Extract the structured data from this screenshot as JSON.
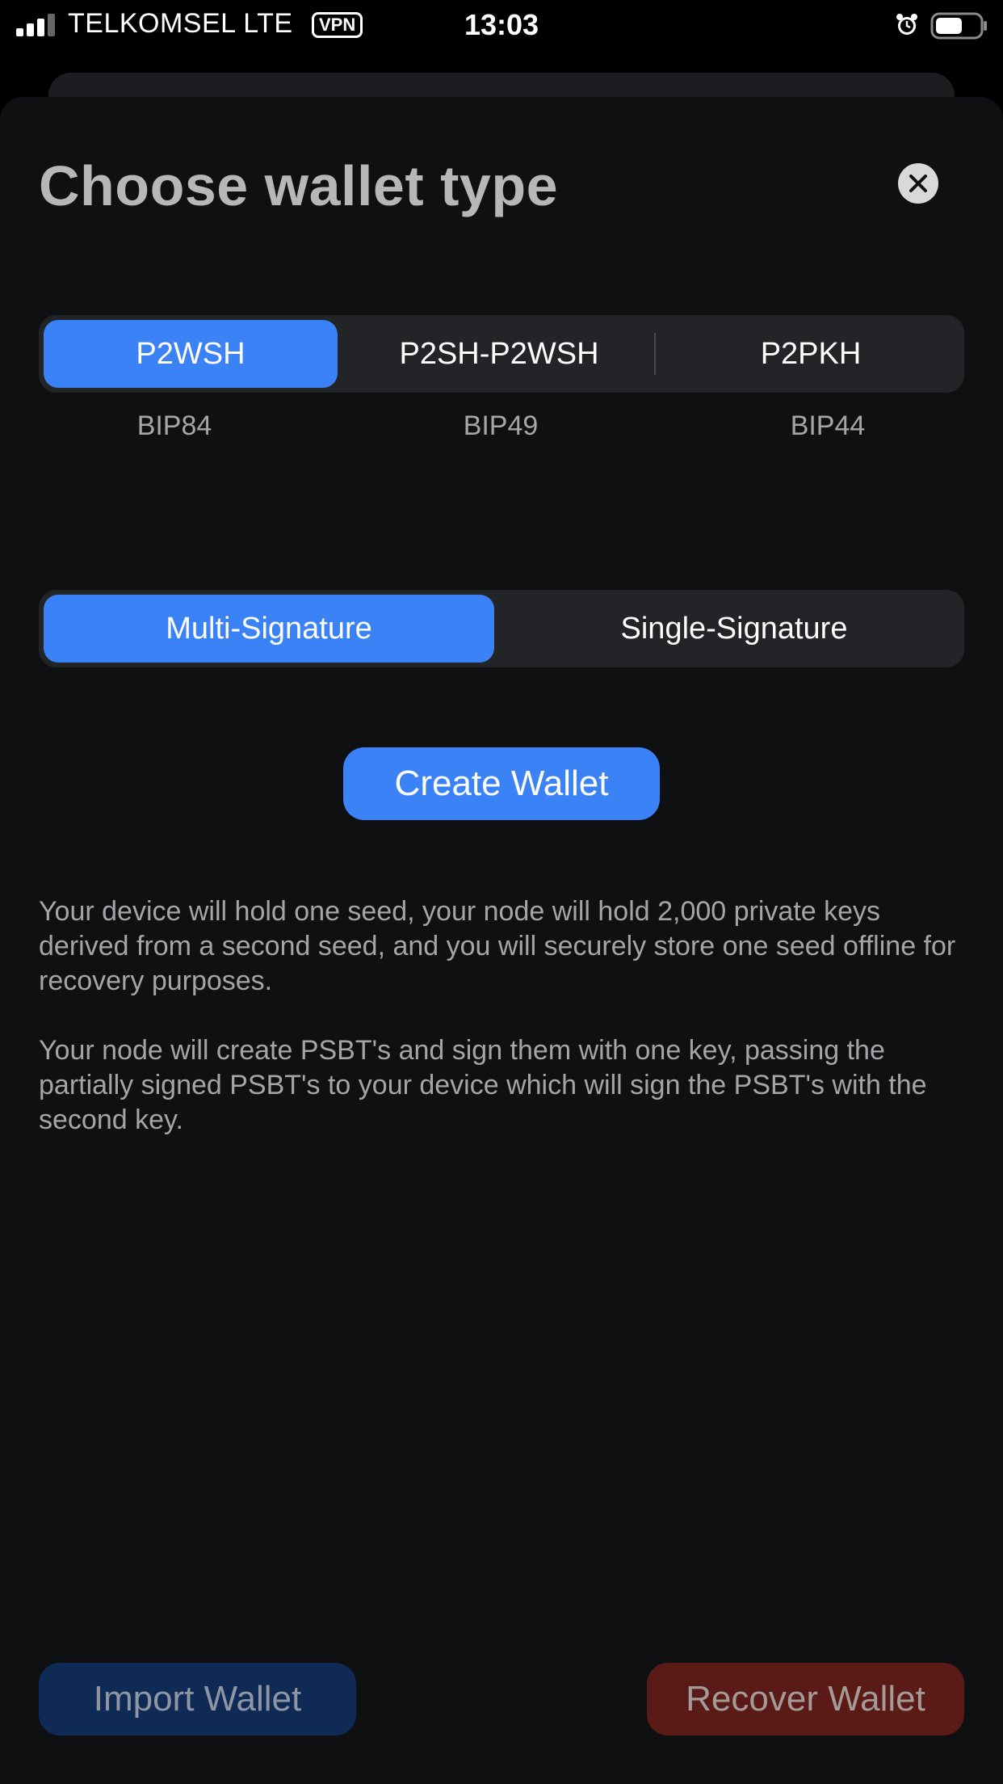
{
  "status_bar": {
    "carrier": "TELKOMSEL  LTE",
    "vpn": "VPN",
    "time": "13:03",
    "icons": [
      "signal-icon",
      "alarm-icon",
      "battery-icon"
    ]
  },
  "sheet": {
    "title": "Choose wallet type",
    "close_icon": "close-icon"
  },
  "address_type": {
    "options": [
      {
        "label": "P2WSH",
        "bip": "BIP84",
        "selected": true
      },
      {
        "label": "P2SH-P2WSH",
        "bip": "BIP49",
        "selected": false
      },
      {
        "label": "P2PKH",
        "bip": "BIP44",
        "selected": false
      }
    ]
  },
  "signature_type": {
    "options": [
      {
        "label": "Multi-Signature",
        "selected": true
      },
      {
        "label": "Single-Signature",
        "selected": false
      }
    ]
  },
  "create_button": "Create Wallet",
  "description": [
    "Your device will hold one seed, your node will hold 2,000 private keys derived from a second seed, and you will securely store one seed offline for recovery purposes.",
    "Your node will create PSBT's and sign them with one key, passing the partially signed PSBT's to your device which will sign the PSBT's with the second key."
  ],
  "footer": {
    "import_label": "Import Wallet",
    "recover_label": "Recover Wallet"
  },
  "colors": {
    "accent": "#3a82f6",
    "import_bg": "#0f2a55",
    "recover_bg": "#5a1a16",
    "sheet_bg": "#0f1012"
  }
}
